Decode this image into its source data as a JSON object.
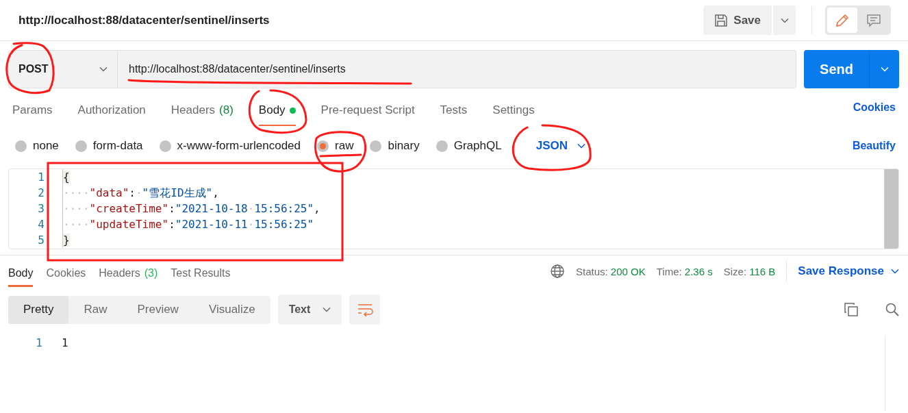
{
  "title": "http://localhost:88/datacenter/sentinel/inserts",
  "save": {
    "label": "Save"
  },
  "mode_toggle": [
    {
      "kind": "edit",
      "selected": true
    },
    {
      "kind": "comment",
      "selected": false
    }
  ],
  "request": {
    "method": "POST",
    "url": "http://localhost:88/datacenter/sentinel/inserts",
    "send": "Send"
  },
  "request_tabs": [
    {
      "label": "Params",
      "selected": false,
      "indicator": false
    },
    {
      "label": "Authorization",
      "selected": false,
      "indicator": false
    },
    {
      "label": "Headers",
      "count": "(8)",
      "selected": false,
      "indicator": false
    },
    {
      "label": "Body",
      "selected": true,
      "indicator": true
    },
    {
      "label": "Pre-request Script",
      "selected": false,
      "indicator": false
    },
    {
      "label": "Tests",
      "selected": false,
      "indicator": false
    },
    {
      "label": "Settings",
      "selected": false,
      "indicator": false
    }
  ],
  "cookies_link": "Cookies",
  "body_types": [
    {
      "label": "none",
      "selected": false
    },
    {
      "label": "form-data",
      "selected": false
    },
    {
      "label": "x-www-form-urlencoded",
      "selected": false
    },
    {
      "label": "raw",
      "selected": true
    },
    {
      "label": "binary",
      "selected": false
    },
    {
      "label": "GraphQL",
      "selected": false
    }
  ],
  "language": "JSON",
  "beautify": "Beautify",
  "editor": {
    "lines": [
      {
        "number": "1",
        "tokens": [
          {
            "kind": "brace",
            "text": "{"
          }
        ]
      },
      {
        "number": "2",
        "tokens": [
          {
            "kind": "ws",
            "text": "····"
          },
          {
            "kind": "key",
            "text": "\"data\""
          },
          {
            "kind": "punct",
            "text": ":"
          },
          {
            "kind": "ws",
            "text": "·"
          },
          {
            "kind": "string",
            "text": "\"雪花ID生成\""
          },
          {
            "kind": "punct",
            "text": ","
          }
        ]
      },
      {
        "number": "3",
        "tokens": [
          {
            "kind": "ws",
            "text": "····"
          },
          {
            "kind": "key",
            "text": "\"createTime\""
          },
          {
            "kind": "punct",
            "text": ":"
          },
          {
            "kind": "string",
            "text": "\"2021-10-18"
          },
          {
            "kind": "ws",
            "text": "·"
          },
          {
            "kind": "string",
            "text": "15:56:25\""
          },
          {
            "kind": "punct",
            "text": ","
          }
        ]
      },
      {
        "number": "4",
        "tokens": [
          {
            "kind": "ws",
            "text": "····"
          },
          {
            "kind": "key",
            "text": "\"updateTime\""
          },
          {
            "kind": "punct",
            "text": ":"
          },
          {
            "kind": "string",
            "text": "\"2021-10-11"
          },
          {
            "kind": "ws",
            "text": "·"
          },
          {
            "kind": "string",
            "text": "15:56:25\""
          }
        ]
      },
      {
        "number": "5",
        "tokens": [
          {
            "kind": "brace",
            "text": "}"
          }
        ]
      }
    ]
  },
  "response_tabs": [
    {
      "label": "Body",
      "selected": true
    },
    {
      "label": "Cookies",
      "selected": false
    },
    {
      "label": "Headers",
      "count": "(3)",
      "selected": false
    },
    {
      "label": "Test Results",
      "selected": false
    }
  ],
  "status": [
    {
      "label": "Status:",
      "value": "200 OK"
    },
    {
      "label": "Time:",
      "value": "2.36 s"
    },
    {
      "label": "Size:",
      "value": "116 B"
    }
  ],
  "save_response": "Save Response",
  "view_modes": [
    {
      "label": "Pretty",
      "selected": true
    },
    {
      "label": "Raw",
      "selected": false
    },
    {
      "label": "Preview",
      "selected": false
    },
    {
      "label": "Visualize",
      "selected": false
    }
  ],
  "format": "Text",
  "response_lines": [
    {
      "number": "1",
      "text": "1"
    }
  ]
}
